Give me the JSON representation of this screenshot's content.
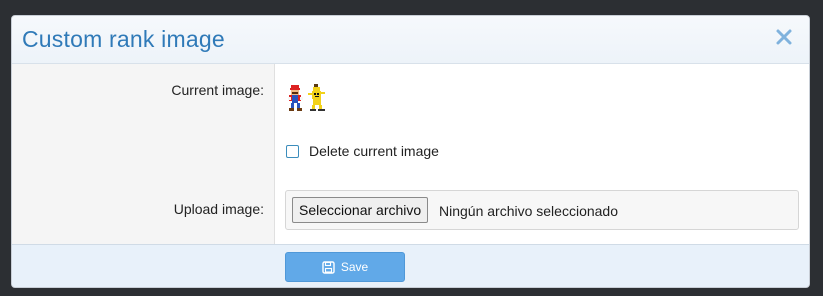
{
  "dialog": {
    "title": "Custom rank image",
    "close_icon": "close-icon"
  },
  "form": {
    "current_image_label": "Current image:",
    "current_image_icon": "mario-banana-sprite",
    "delete_label": "Delete current image",
    "delete_checked": false,
    "upload_label": "Upload image:",
    "file_button_label": "Seleccionar archivo",
    "file_status": "Ningún archivo seleccionado"
  },
  "footer": {
    "save_label": "Save",
    "save_icon": "floppy-disk-icon"
  },
  "colors": {
    "title": "#2f7ab8",
    "save_button": "#61a9e8",
    "label_column_bg": "#f5f5f5",
    "footer_bg": "#e8f1fa"
  }
}
